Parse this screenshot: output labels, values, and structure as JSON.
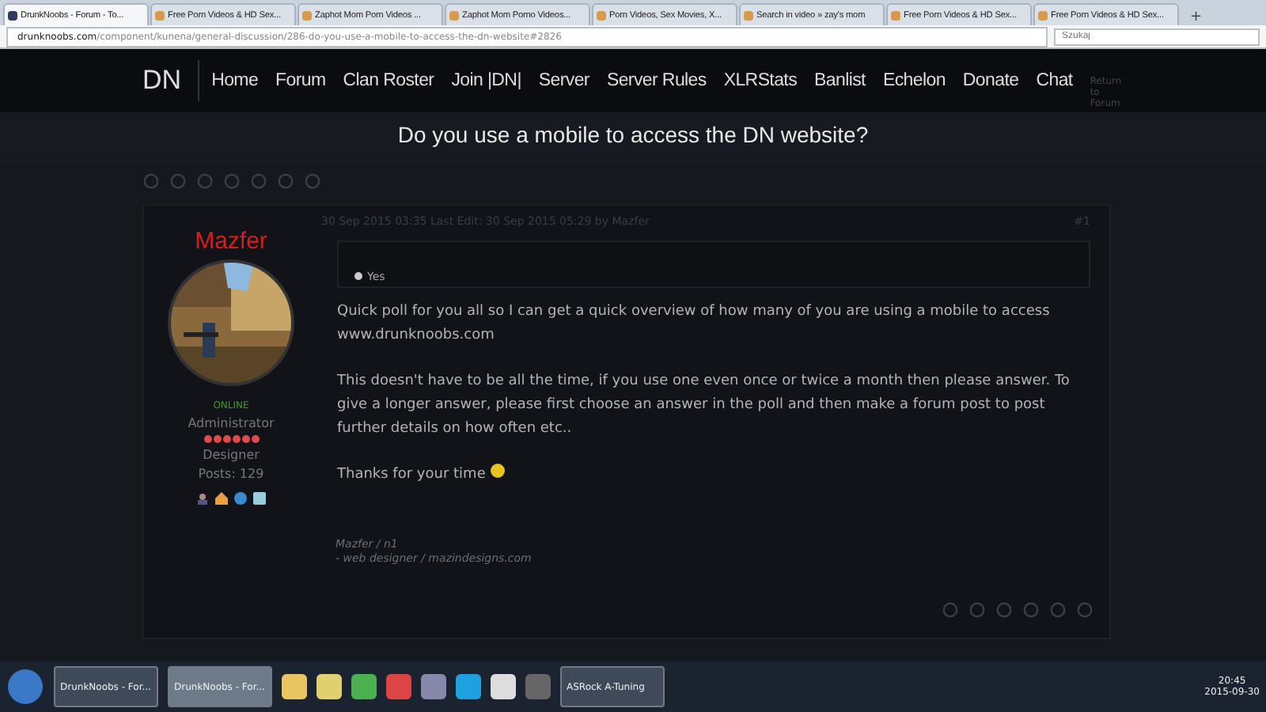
{
  "browser": {
    "tabs": [
      {
        "label": "DrunkNoobs - Forum - To...",
        "selected": true
      },
      {
        "label": "Free Porn Videos & HD Sex...",
        "selected": false
      },
      {
        "label": "Zaphot Mom Porn Videos ...",
        "selected": false
      },
      {
        "label": "Zaphot Mom Porno Videos...",
        "selected": false
      },
      {
        "label": "Porn Videos, Sex Movies, X...",
        "selected": false
      },
      {
        "label": "Search in video » zay's mom",
        "selected": false
      },
      {
        "label": "Free Porn Videos & HD Sex...",
        "selected": false
      },
      {
        "label": "Free Porn Videos & HD Sex...",
        "selected": false
      }
    ],
    "new_tab": "+",
    "address": {
      "host": "drunknoobs.com",
      "path": "/component/kunena/general-discussion/286-do-you-use-a-mobile-to-access-the-dn-website#2826"
    },
    "search": {
      "placeholder": "Szukaj"
    }
  },
  "site": {
    "logo": "DN",
    "nav": [
      "Home",
      "Forum",
      "Clan Roster",
      "Join |DN|",
      "Server",
      "Server Rules",
      "XLRStats",
      "Banlist",
      "Echelon",
      "Donate",
      "Chat"
    ],
    "return_link": "Return to Forum"
  },
  "topic": {
    "title": "Do you use a mobile to access the DN website?"
  },
  "post": {
    "author": "Mazfer",
    "status": "ONLINE",
    "role": "Administrator",
    "rank_title": "Designer",
    "posts": "Posts: 129",
    "meta": "30 Sep 2015 03:35   Last Edit: 30 Sep 2015 05:29 by Mazfer",
    "number": "#1",
    "poll_option": "Yes",
    "paragraphs": [
      "Quick poll for you all so I can get a quick overview of how many of you are using a mobile to access www.drunknoobs.com",
      "This doesn't have to be all the time, if you use one even once or twice a month then please answer. To give a longer answer, please first choose an answer in the poll and then make a forum post to post further details on how often etc..",
      "Thanks for your time"
    ],
    "signature": [
      "Mazfer / n1",
      "- web designer / *mazindesigns.com*"
    ]
  },
  "taskbar": {
    "windows": [
      {
        "label": "DrunkNoobs - For...",
        "selected": false
      },
      {
        "label": "DrunkNoobs - For...",
        "selected": true
      }
    ],
    "app": "ASRock A-Tuning",
    "time": "20:45",
    "date": "2015-09-30"
  }
}
